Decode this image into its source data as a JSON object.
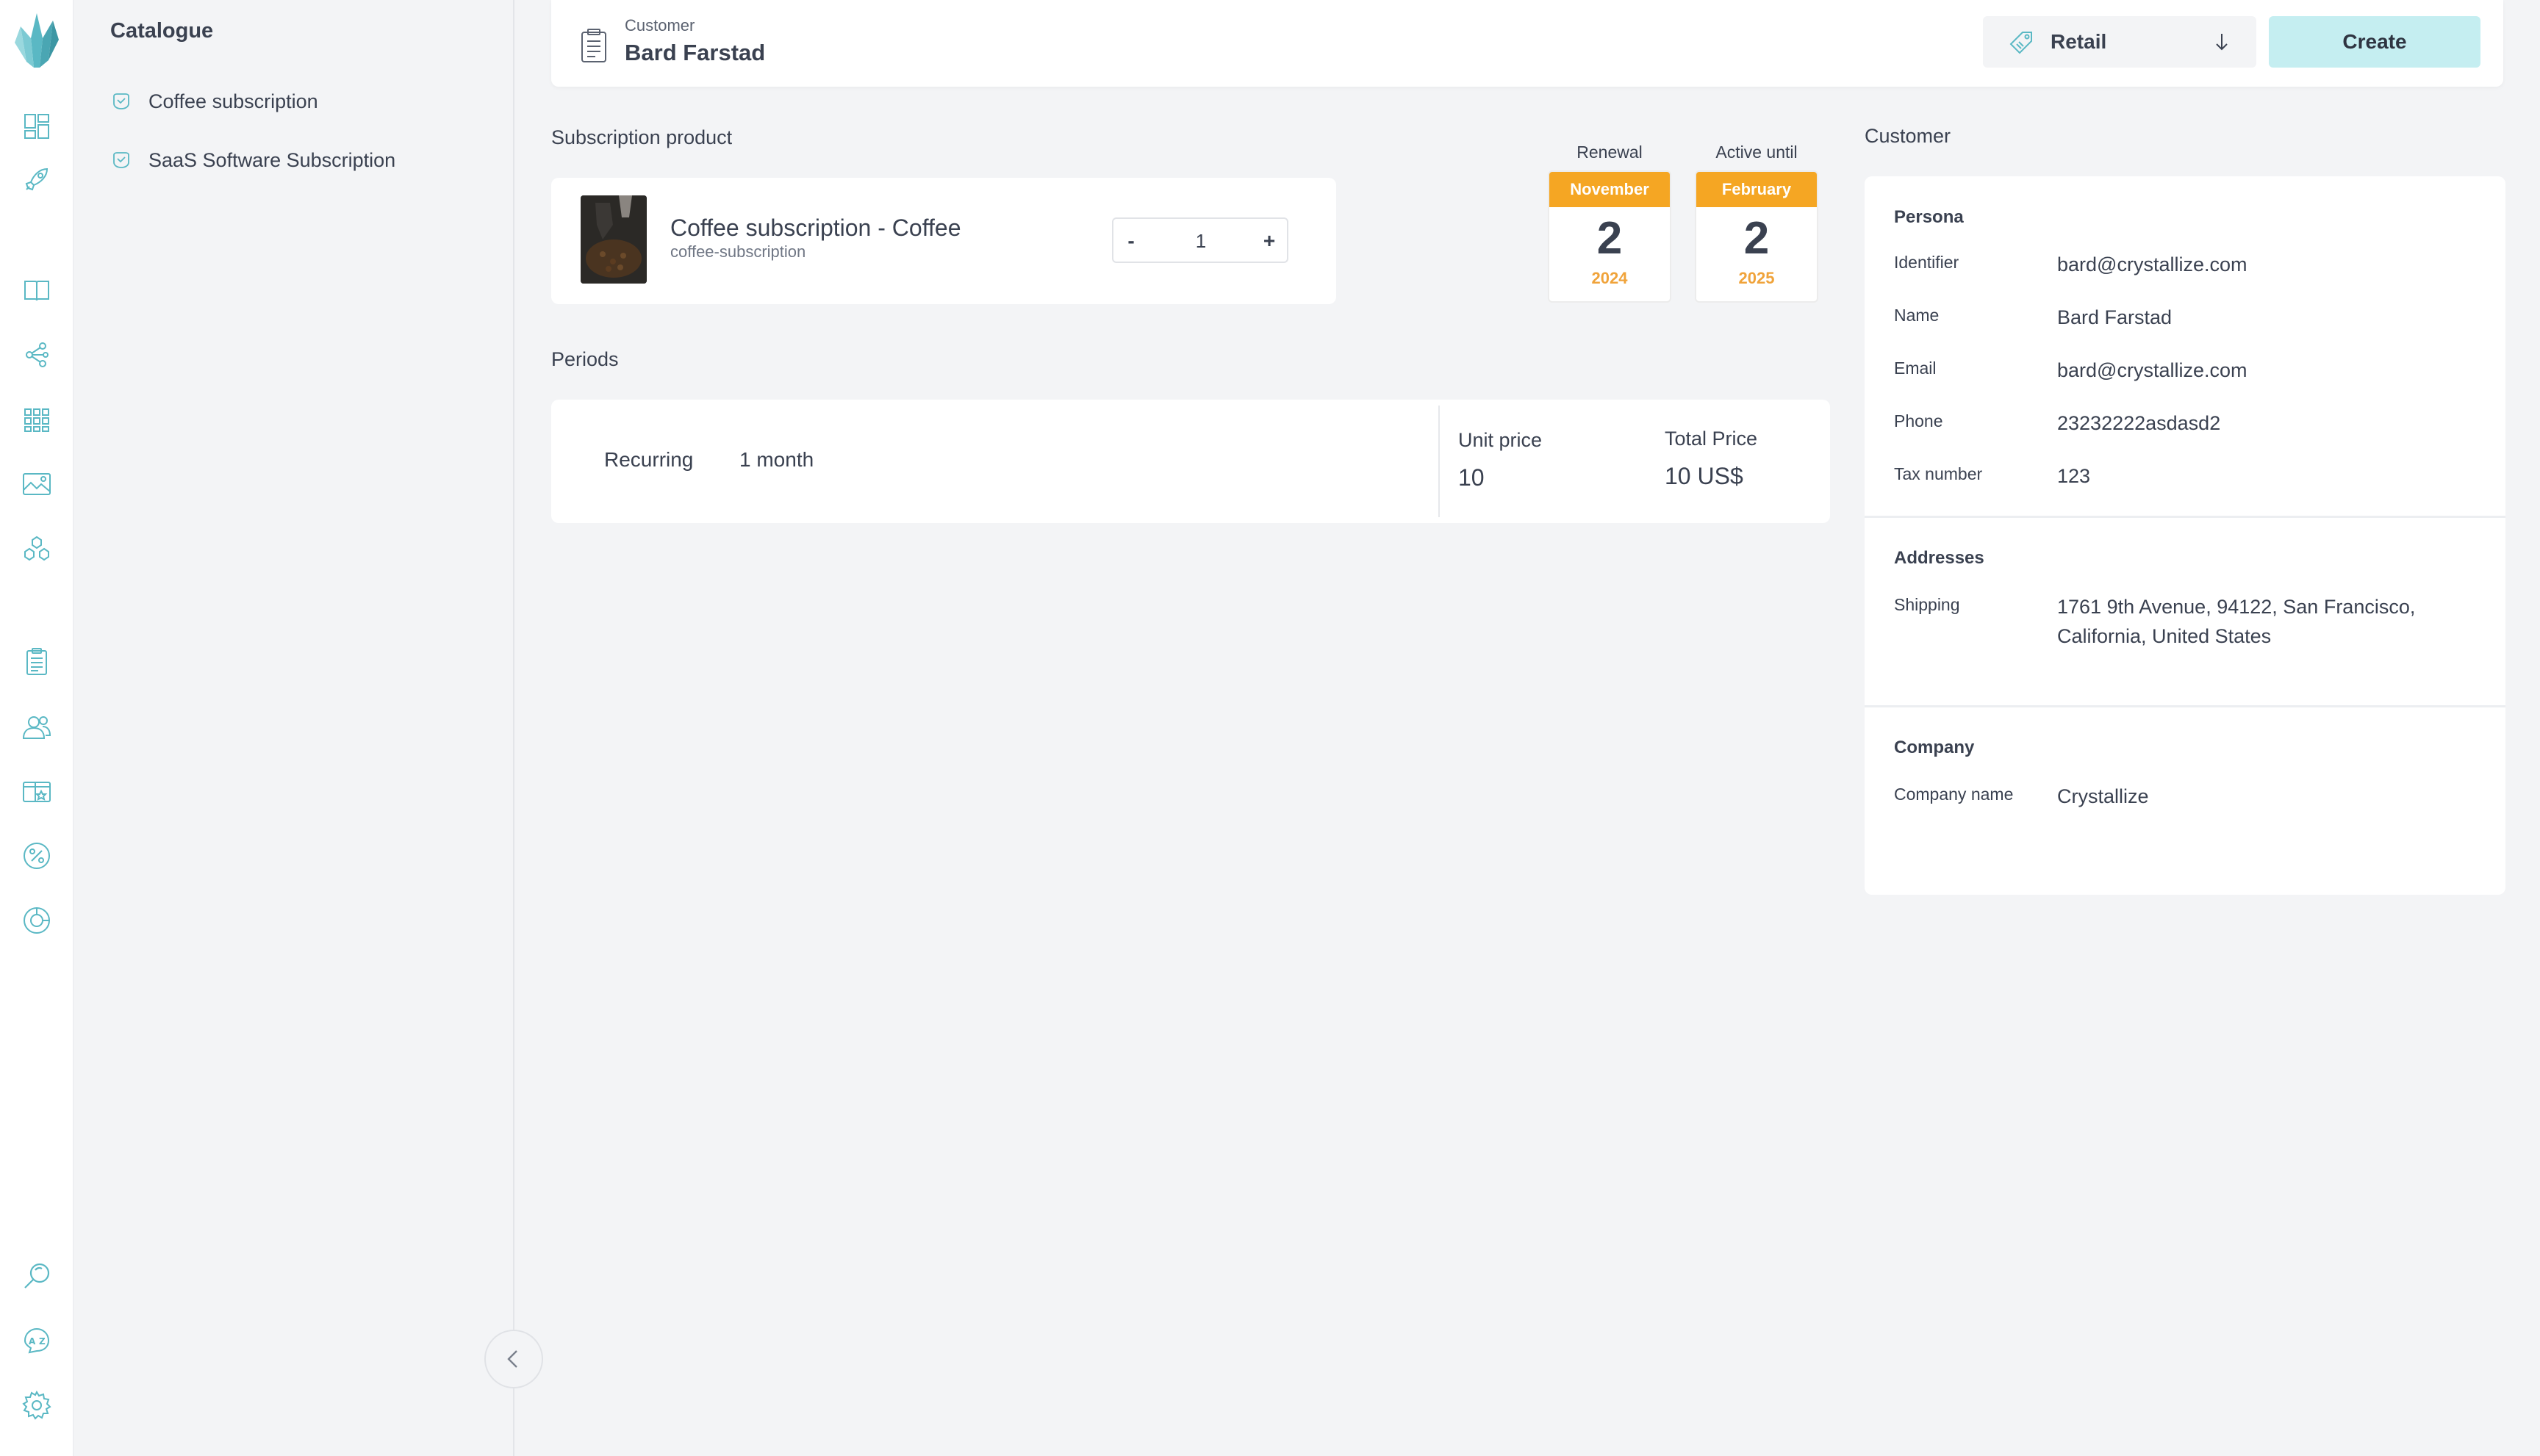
{
  "rail": {
    "icons": [
      "crystallize-logo",
      "dashboard-icon",
      "rocket-icon",
      "book-icon",
      "graph-icon",
      "grid-icon",
      "image-icon",
      "shapes-icon",
      "clipboard-icon",
      "users-icon",
      "box-icon",
      "discount-icon",
      "chart-icon",
      "search-icon",
      "translate-icon",
      "gear-icon"
    ],
    "accent": "#5ab8c4"
  },
  "catalogue": {
    "title": "Catalogue",
    "items": [
      {
        "label": "Coffee subscription"
      },
      {
        "label": "SaaS Software Subscription"
      }
    ]
  },
  "header": {
    "customer_label": "Customer",
    "customer_name": "Bard Farstad",
    "price_list": "Retail",
    "create_label": "Create"
  },
  "product": {
    "section_title": "Subscription product",
    "title": "Coffee subscription - Coffee",
    "sku": "coffee-subscription",
    "quantity": "1",
    "minus": "-",
    "plus": "+"
  },
  "renewal": {
    "label": "Renewal",
    "month": "November",
    "day": "2",
    "year": "2024"
  },
  "active_until": {
    "label": "Active until",
    "month": "February",
    "day": "2",
    "year": "2025"
  },
  "periods": {
    "section_title": "Periods",
    "recurring_label": "Recurring",
    "recurring_value": "1 month",
    "unit_price_label": "Unit price",
    "unit_price_value": "10",
    "total_price_label": "Total Price",
    "total_price_value": "10 US$"
  },
  "customer": {
    "section_title": "Customer",
    "persona_title": "Persona",
    "identifier_label": "Identifier",
    "identifier_value": "bard@crystallize.com",
    "name_label": "Name",
    "name_value": "Bard Farstad",
    "email_label": "Email",
    "email_value": "bard@crystallize.com",
    "phone_label": "Phone",
    "phone_value": "23232222asdasd2",
    "tax_label": "Tax number",
    "tax_value": "123",
    "addresses_title": "Addresses",
    "shipping_label": "Shipping",
    "shipping_value": "1761 9th Avenue, 94122, San Francisco, California, United States",
    "company_title": "Company",
    "company_name_label": "Company name",
    "company_name_value": "Crystallize"
  },
  "colors": {
    "accent": "#5ab8c4",
    "calendar_orange": "#f5a623",
    "create_bg": "#c5eef1"
  }
}
